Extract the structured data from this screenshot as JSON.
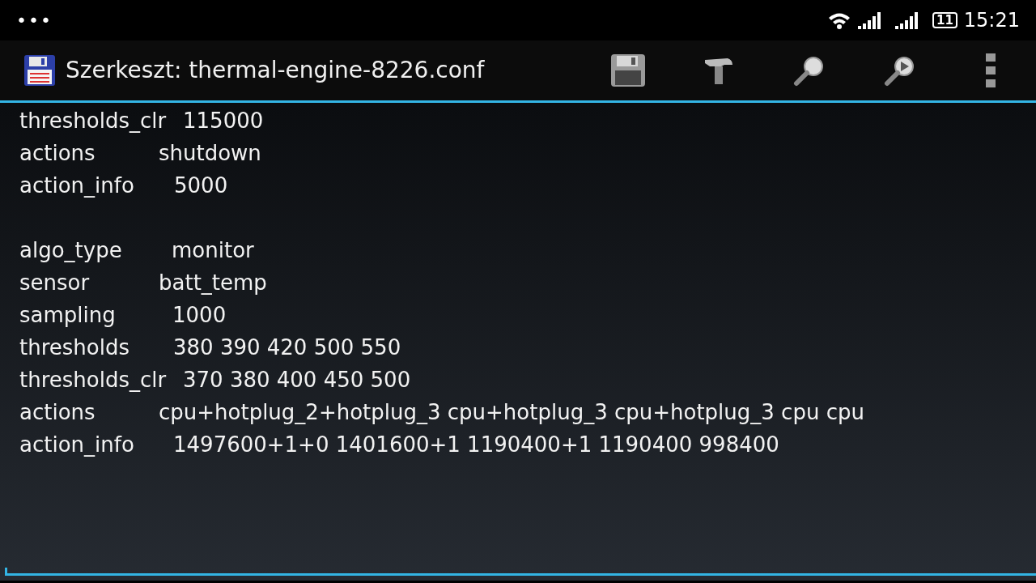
{
  "status_bar": {
    "notifications": "•••",
    "time": "15:21",
    "battery": "11"
  },
  "action_bar": {
    "title": "Szerkeszt: thermal-engine-8226.conf"
  },
  "editor": {
    "lines": [
      {
        "kind": "pair",
        "key": "thresholds_clr",
        "value": "115000"
      },
      {
        "kind": "pair",
        "key": "actions",
        "value": "shutdown"
      },
      {
        "kind": "pair",
        "key": "action_info",
        "value": "5000"
      },
      {
        "kind": "blank"
      },
      {
        "kind": "pair",
        "key": "algo_type",
        "value": "monitor"
      },
      {
        "kind": "pair",
        "key": "sensor",
        "value": "batt_temp"
      },
      {
        "kind": "pair",
        "key": "sampling",
        "value": "1000"
      },
      {
        "kind": "pair",
        "key": "thresholds",
        "value": "380 390 420 500 550"
      },
      {
        "kind": "pair",
        "key": "thresholds_clr",
        "value": "370 380 400 450 500"
      },
      {
        "kind": "pair",
        "key": "actions",
        "value": "cpu+hotplug_2+hotplug_3 cpu+hotplug_3 cpu+hotplug_3 cpu cpu"
      },
      {
        "kind": "pair",
        "key": "action_info",
        "value": "1497600+1+0 1401600+1 1190400+1 1190400 998400"
      }
    ]
  }
}
